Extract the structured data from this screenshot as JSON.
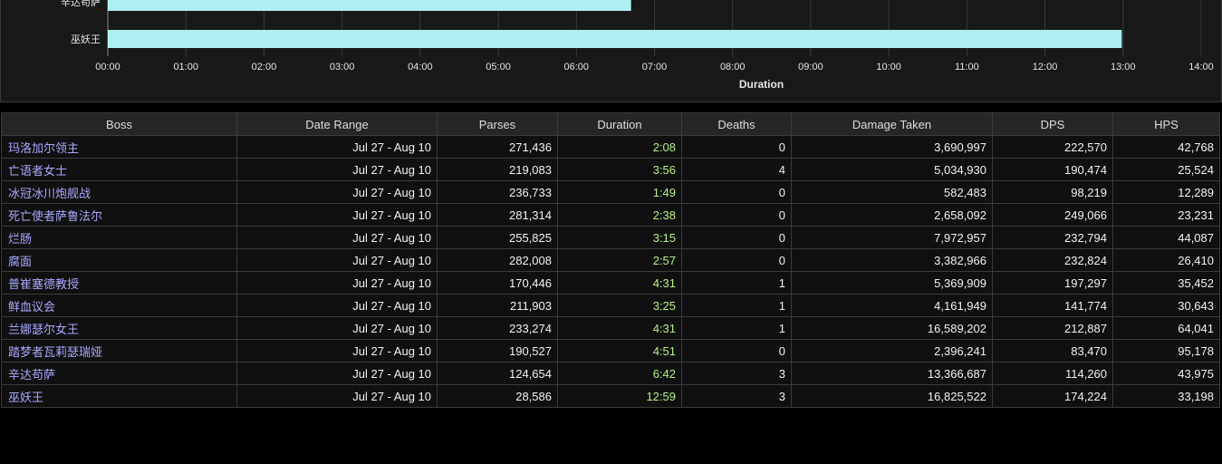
{
  "chart_data": {
    "type": "bar",
    "orientation": "horizontal",
    "categories": [
      "辛达苟萨",
      "巫妖王"
    ],
    "values_seconds": [
      402,
      779
    ],
    "values_display": [
      "6:42",
      "12:59"
    ],
    "bar_color": "#aef0f0",
    "xlabel": "Duration",
    "xlim_seconds": [
      0,
      840
    ],
    "x_tick_labels": [
      "00:00",
      "01:00",
      "02:00",
      "03:00",
      "04:00",
      "05:00",
      "06:00",
      "07:00",
      "08:00",
      "09:00",
      "10:00",
      "11:00",
      "12:00",
      "13:00",
      "14:00"
    ],
    "grid": true
  },
  "table": {
    "columns": [
      "Boss",
      "Date Range",
      "Parses",
      "Duration",
      "Deaths",
      "Damage Taken",
      "DPS",
      "HPS"
    ],
    "rows": [
      [
        "玛洛加尔领主",
        "Jul 27 - Aug 10",
        "271,436",
        "2:08",
        "0",
        "3,690,997",
        "222,570",
        "42,768"
      ],
      [
        "亡语者女士",
        "Jul 27 - Aug 10",
        "219,083",
        "3:56",
        "4",
        "5,034,930",
        "190,474",
        "25,524"
      ],
      [
        "冰冠冰川炮舰战",
        "Jul 27 - Aug 10",
        "236,733",
        "1:49",
        "0",
        "582,483",
        "98,219",
        "12,289"
      ],
      [
        "死亡使者萨鲁法尔",
        "Jul 27 - Aug 10",
        "281,314",
        "2:38",
        "0",
        "2,658,092",
        "249,066",
        "23,231"
      ],
      [
        "烂肠",
        "Jul 27 - Aug 10",
        "255,825",
        "3:15",
        "0",
        "7,972,957",
        "232,794",
        "44,087"
      ],
      [
        "腐面",
        "Jul 27 - Aug 10",
        "282,008",
        "2:57",
        "0",
        "3,382,966",
        "232,824",
        "26,410"
      ],
      [
        "普崔塞德教授",
        "Jul 27 - Aug 10",
        "170,446",
        "4:31",
        "1",
        "5,369,909",
        "197,297",
        "35,452"
      ],
      [
        "鲜血议会",
        "Jul 27 - Aug 10",
        "211,903",
        "3:25",
        "1",
        "4,161,949",
        "141,774",
        "30,643"
      ],
      [
        "兰娜瑟尔女王",
        "Jul 27 - Aug 10",
        "233,274",
        "4:31",
        "1",
        "16,589,202",
        "212,887",
        "64,041"
      ],
      [
        "踏梦者瓦莉瑟瑞娅",
        "Jul 27 - Aug 10",
        "190,527",
        "4:51",
        "0",
        "2,396,241",
        "83,470",
        "95,178"
      ],
      [
        "辛达苟萨",
        "Jul 27 - Aug 10",
        "124,654",
        "6:42",
        "3",
        "13,366,687",
        "114,260",
        "43,975"
      ],
      [
        "巫妖王",
        "Jul 27 - Aug 10",
        "28,586",
        "12:59",
        "3",
        "16,825,522",
        "174,224",
        "33,198"
      ]
    ]
  }
}
